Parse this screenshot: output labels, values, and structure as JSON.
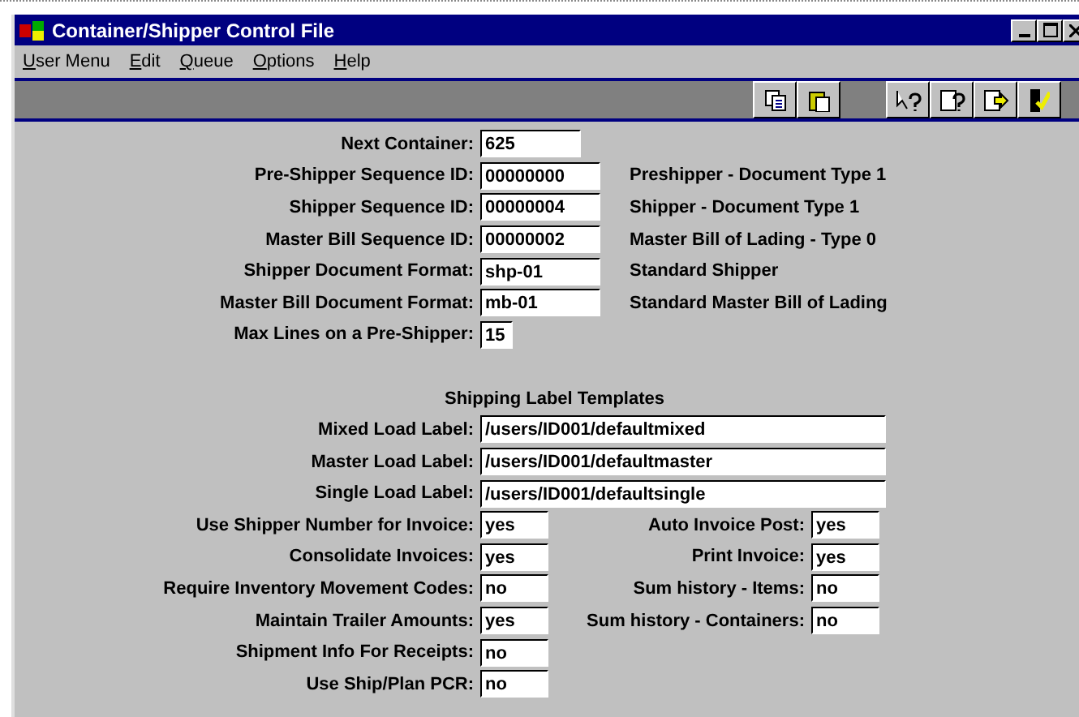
{
  "window": {
    "title": "Container/Shipper Control File"
  },
  "menu": [
    "User Menu",
    "Edit",
    "Queue",
    "Options",
    "Help"
  ],
  "fields": [
    {
      "label": "Next Container:",
      "value": "625",
      "kind": "short"
    },
    {
      "label": "Pre-Shipper Sequence ID:",
      "value": "00000000",
      "kind": "id",
      "description": "Preshipper - Document Type 1"
    },
    {
      "label": "Shipper Sequence ID:",
      "value": "00000004",
      "kind": "id",
      "description": "Shipper - Document Type 1"
    },
    {
      "label": "Master Bill Sequence ID:",
      "value": "00000002",
      "kind": "id",
      "description": "Master Bill of Lading - Type 0"
    },
    {
      "label": "Shipper Document Format:",
      "value": "shp-01",
      "kind": "id",
      "description": "Standard Shipper"
    },
    {
      "label": "Master Bill Document Format:",
      "value": "mb-01",
      "kind": "id",
      "description": "Standard Master Bill of Lading"
    },
    {
      "label": "Max Lines on a Pre-Shipper:",
      "value": "15",
      "kind": "tiny"
    }
  ],
  "templates": {
    "heading": "Shipping Label Templates",
    "fields": [
      {
        "label": "Mixed Load Label:",
        "value": "/users/ID001/defaultmixed"
      },
      {
        "label": "Master Load Label:",
        "value": "/users/ID001/defaultmaster"
      },
      {
        "label": "Single Load Label:",
        "value": "/users/ID001/defaultsingle"
      }
    ]
  },
  "options_left": [
    {
      "label": "Use Shipper Number for Invoice:",
      "value": "yes"
    },
    {
      "label": "Consolidate Invoices:",
      "value": "yes"
    },
    {
      "label": "Require Inventory Movement Codes:",
      "value": "no"
    },
    {
      "label": "Maintain Trailer Amounts:",
      "value": "yes"
    },
    {
      "label": "Shipment Info For Receipts:",
      "value": "no"
    },
    {
      "label": "Use Ship/Plan PCR:",
      "value": "no"
    }
  ],
  "options_right": [
    {
      "label": "Auto Invoice Post:",
      "value": "yes"
    },
    {
      "label": "Print Invoice:",
      "value": "yes"
    },
    {
      "label": "Sum history - Items:",
      "value": "no"
    },
    {
      "label": "Sum history - Containers:",
      "value": "no"
    }
  ]
}
